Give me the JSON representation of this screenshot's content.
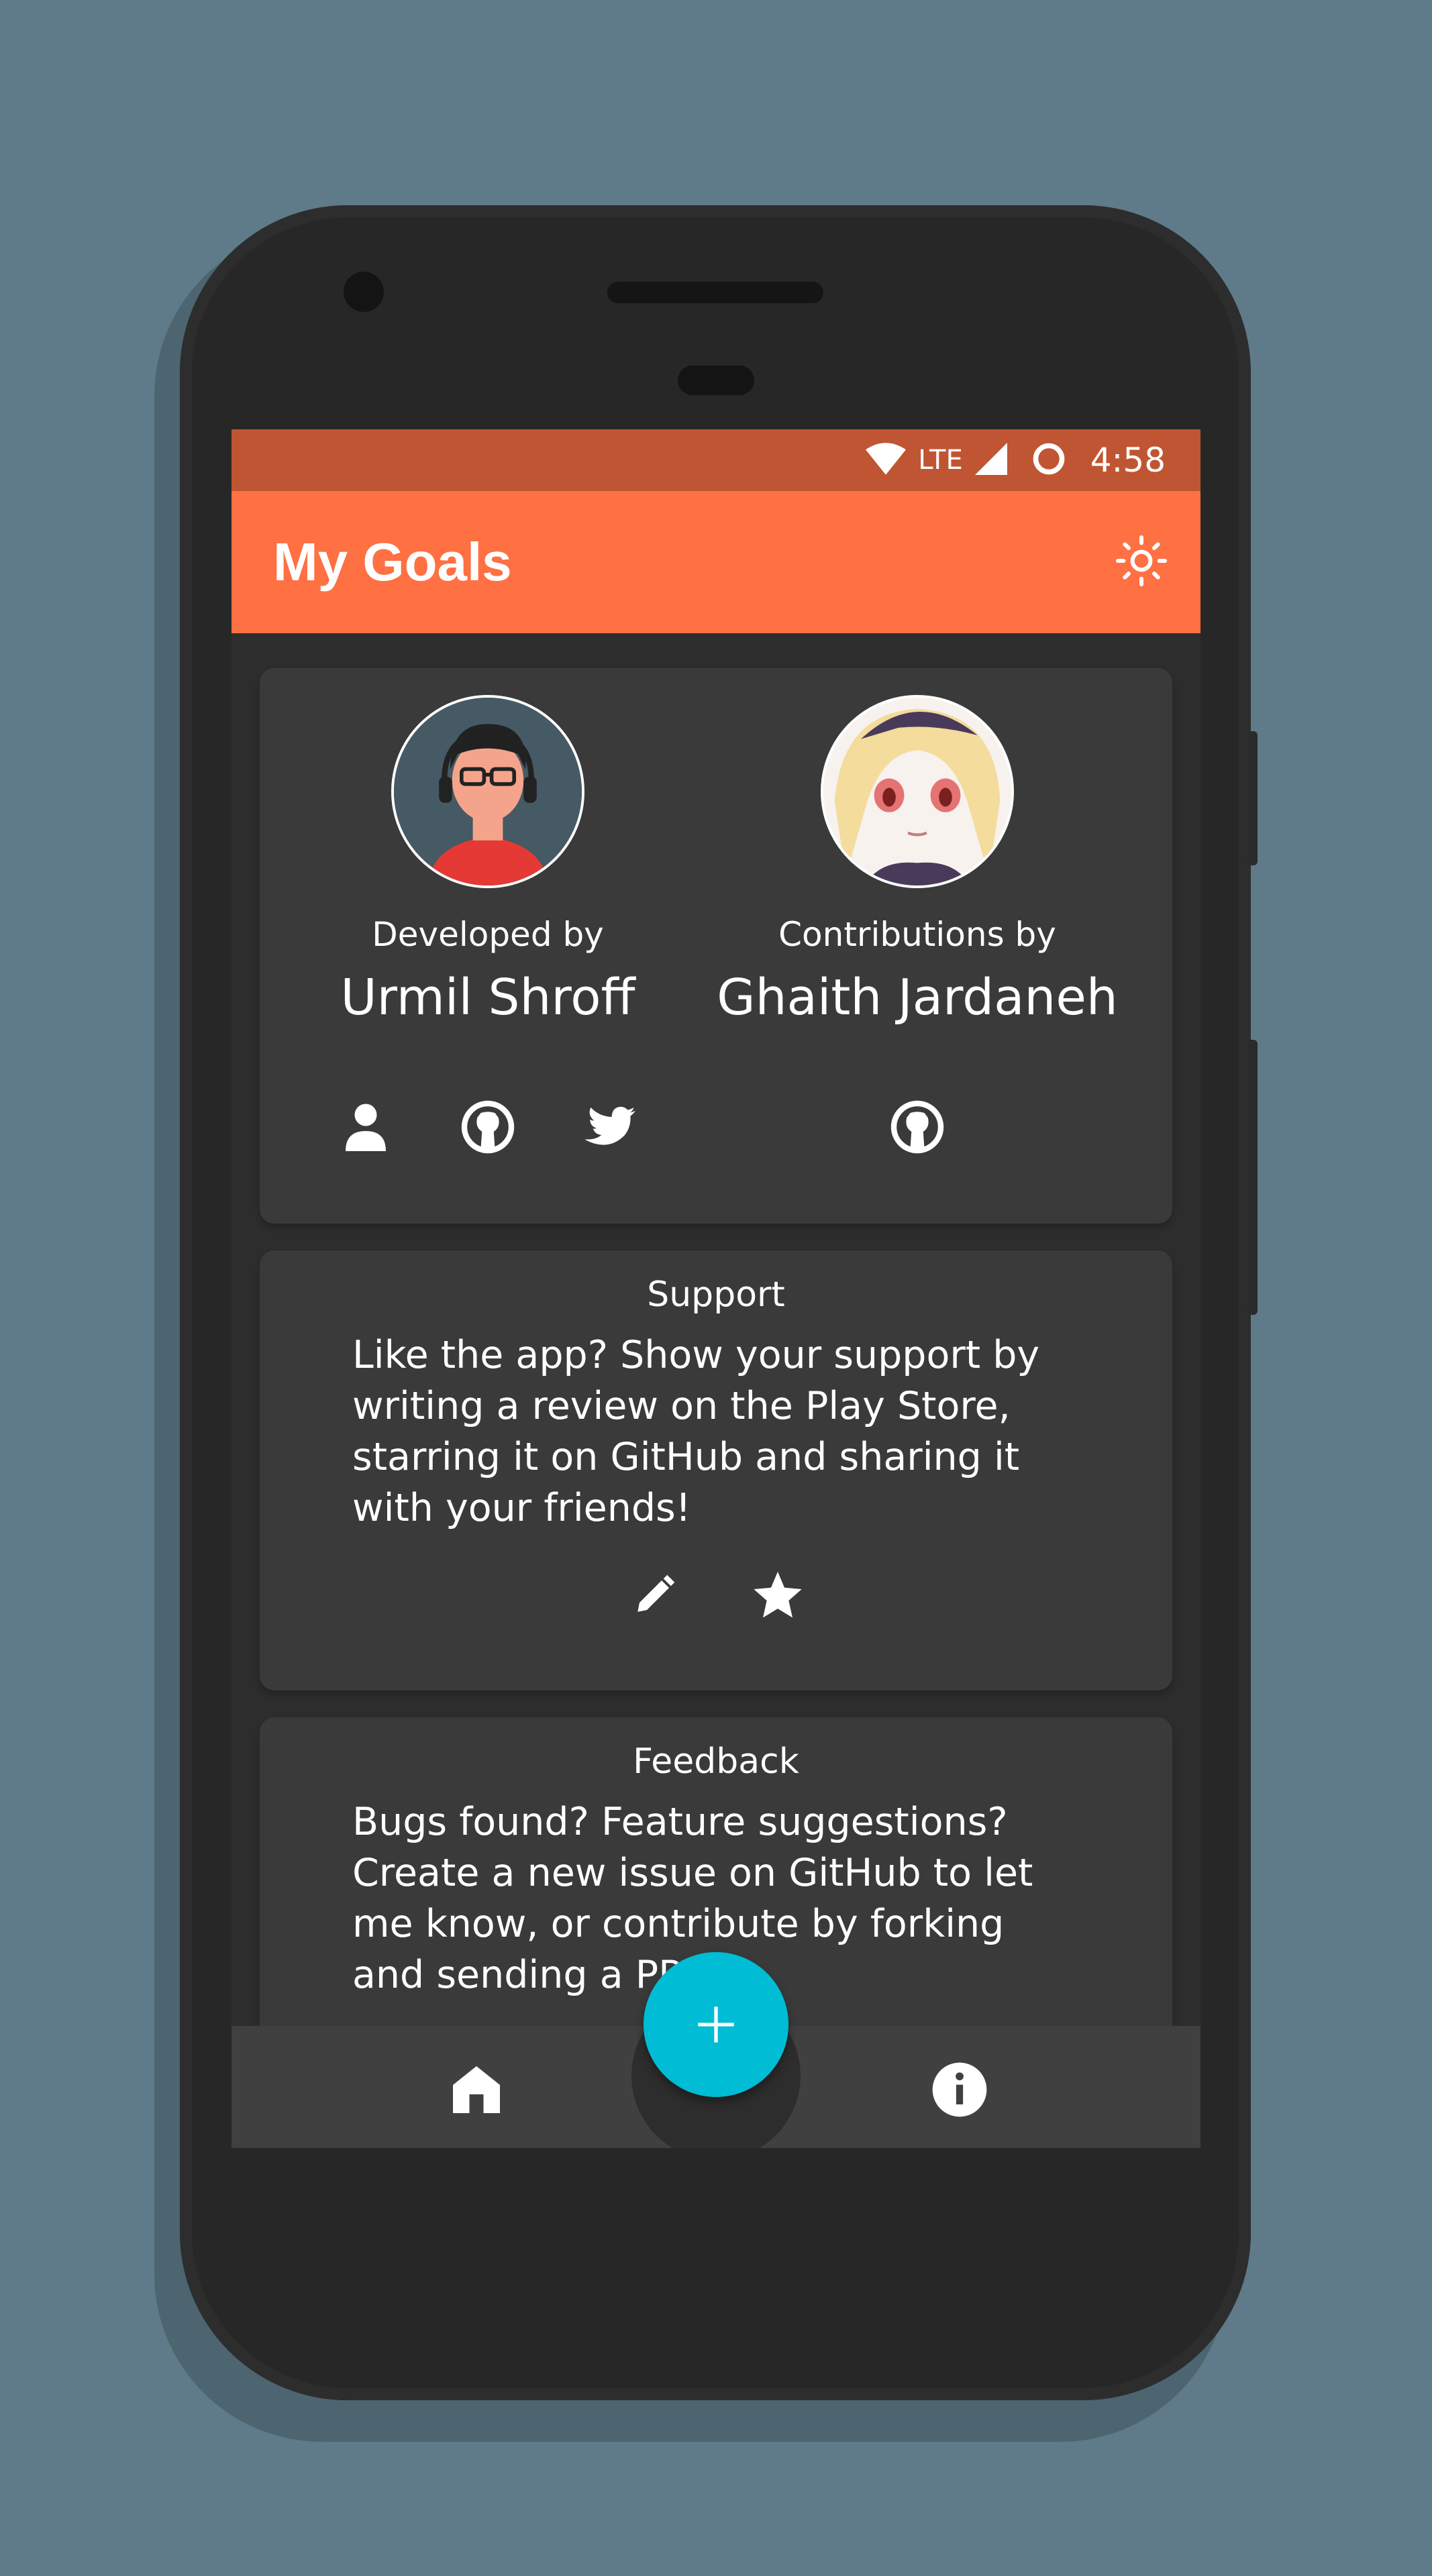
{
  "status_bar": {
    "network": "LTE",
    "time": "4:58"
  },
  "app_bar": {
    "title": "My Goals",
    "theme_icon": "brightness-icon"
  },
  "developer": {
    "role": "Developed by",
    "name": "Urmil Shroff",
    "links": [
      "person-icon",
      "github-icon",
      "twitter-icon"
    ]
  },
  "contributor": {
    "role": "Contributions by",
    "name": "Ghaith Jardaneh",
    "links": [
      "github-icon"
    ]
  },
  "support": {
    "title": "Support",
    "body": "Like the app? Show your support by writing a review on the Play Store, starring it on GitHub and sharing it with your friends!",
    "actions": [
      "pencil-icon",
      "star-icon"
    ]
  },
  "feedback": {
    "title": "Feedback",
    "body": "Bugs found? Feature suggestions? Create a new issue on GitHub to let me know, or contribute by forking and sending a PR!"
  },
  "bottom_nav": {
    "items": [
      "home-icon",
      "info-icon"
    ],
    "fab_icon": "plus-icon"
  },
  "colors": {
    "background": "#5f7b89",
    "status_bar": "#bf5532",
    "app_bar": "#ff7043",
    "card": "#3a3a3a",
    "fab": "#00bcd4"
  }
}
